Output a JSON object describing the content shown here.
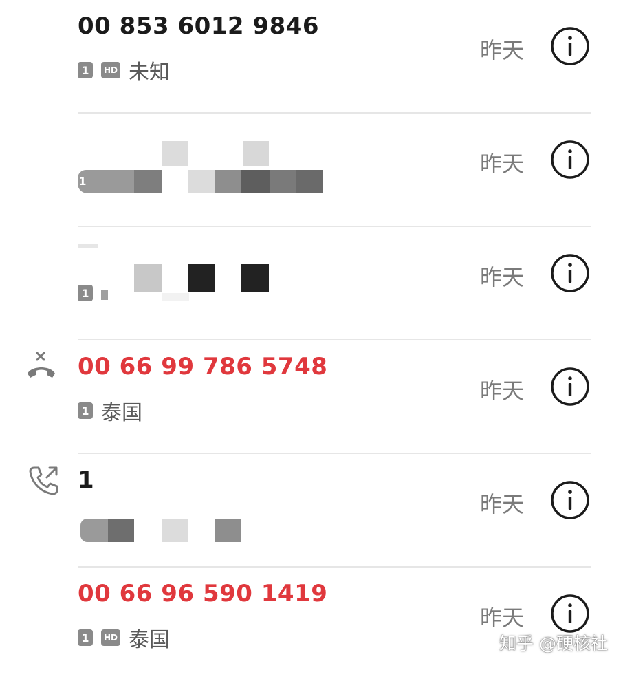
{
  "calls": [
    {
      "number": "00 853 6012 9846",
      "status": "normal",
      "sim_label": "1",
      "hd": true,
      "hd_label": "HD",
      "location": "未知",
      "date": "昨天",
      "type_icon": null,
      "redacted": false
    },
    {
      "number": "",
      "status": "normal",
      "sim_label": "1",
      "hd": false,
      "location": "",
      "date": "昨天",
      "type_icon": null,
      "redacted": true
    },
    {
      "number": "",
      "status": "normal",
      "sim_label": "1",
      "hd": false,
      "location": "",
      "date": "昨天",
      "type_icon": null,
      "redacted": true
    },
    {
      "number": "00 66 99 786 5748",
      "status": "missed",
      "sim_label": "1",
      "hd": false,
      "location": "泰国",
      "date": "昨天",
      "type_icon": "missed-call-icon",
      "redacted": false
    },
    {
      "number": "1",
      "status": "normal",
      "sim_label": "",
      "hd": false,
      "location": "",
      "date": "昨天",
      "type_icon": "outgoing-call-icon",
      "redacted": true
    },
    {
      "number": "00 66 96 590 1419",
      "status": "missed",
      "sim_label": "1",
      "hd": true,
      "hd_label": "HD",
      "location": "泰国",
      "date": "昨天",
      "type_icon": null,
      "redacted": false
    }
  ],
  "icons": {
    "info": "info-icon"
  },
  "colors": {
    "missed": "#e0383d",
    "normal_text": "#1b1b1b",
    "secondary": "#7a7a7a",
    "badge": "#8a8a8a"
  },
  "watermark": "知乎 @硬核社"
}
